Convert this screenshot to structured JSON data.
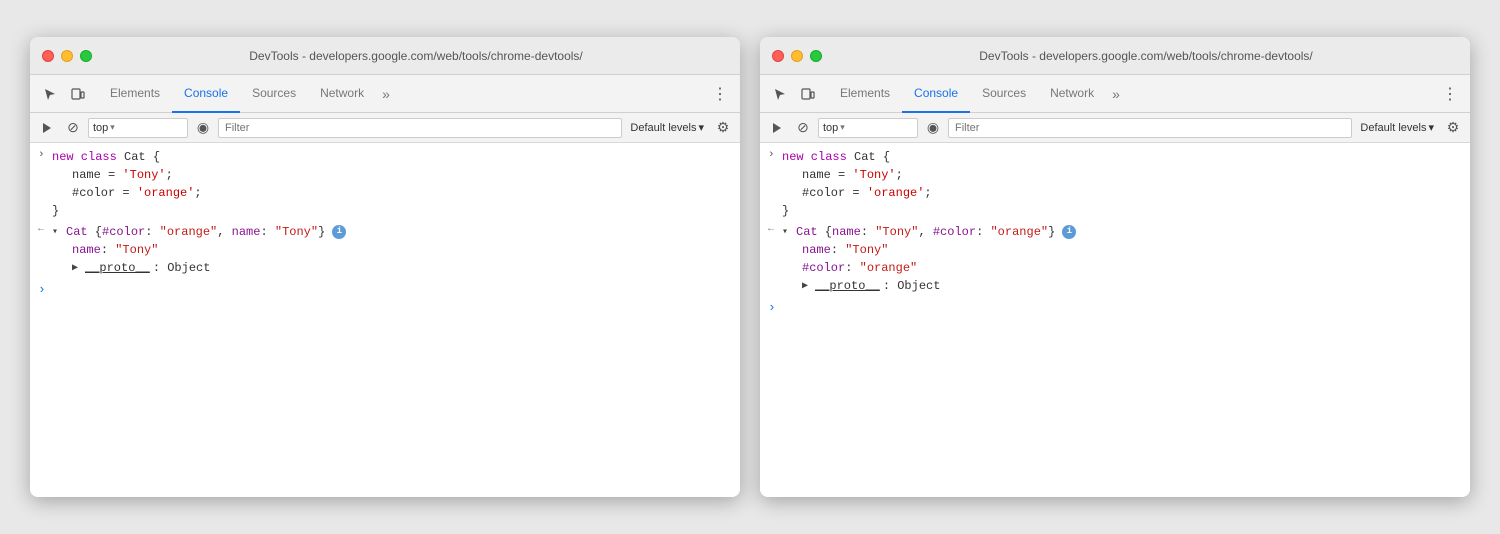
{
  "windows": [
    {
      "id": "window-left",
      "titleBar": {
        "title": "DevTools - developers.google.com/web/tools/chrome-devtools/"
      },
      "tabs": {
        "items": [
          "Elements",
          "Console",
          "Sources",
          "Network"
        ],
        "active": "Console",
        "more": "»"
      },
      "toolbar": {
        "executeIcon": "▶",
        "blockIcon": "⊘",
        "contextLabel": "top",
        "contextArrow": "▾",
        "eyeLabel": "◉",
        "filterPlaceholder": "Filter",
        "defaultLevelsLabel": "Default levels",
        "defaultLevelsArrow": "▾",
        "gearIcon": "⚙"
      },
      "console": {
        "entry1": {
          "arrow": ">",
          "lines": [
            "new class Cat {",
            "  name = 'Tony';",
            "  #color = 'orange';",
            "}"
          ]
        },
        "entry2": {
          "arrowLeft": "<",
          "triangleOpen": "▾",
          "objectLabel": "Cat {#color: ",
          "colorVal": "\"orange\"",
          "comma": ", name: ",
          "nameVal": "\"Tony\"",
          "closeBrace": "}",
          "hasInfoBadge": true,
          "children": [
            {
              "label": "name: ",
              "value": "\"Tony\"",
              "isStr": true
            },
            {
              "triangle": "▶",
              "label": "__proto__",
              "value": ": Object",
              "isProto": true
            }
          ]
        },
        "promptArrow": ">"
      }
    },
    {
      "id": "window-right",
      "titleBar": {
        "title": "DevTools - developers.google.com/web/tools/chrome-devtools/"
      },
      "tabs": {
        "items": [
          "Elements",
          "Console",
          "Sources",
          "Network"
        ],
        "active": "Console",
        "more": "»"
      },
      "toolbar": {
        "executeIcon": "▶",
        "blockIcon": "⊘",
        "contextLabel": "top",
        "contextArrow": "▾",
        "eyeLabel": "◉",
        "filterPlaceholder": "Filter",
        "defaultLevelsLabel": "Default levels",
        "defaultLevelsArrow": "▾",
        "gearIcon": "⚙"
      },
      "console": {
        "entry1": {
          "arrow": ">",
          "lines": [
            "new class Cat {",
            "  name = 'Tony';",
            "  #color = 'orange';",
            "}"
          ]
        },
        "entry2": {
          "arrowLeft": "<",
          "triangleOpen": "▾",
          "objectLabel": "Cat {name: ",
          "nameVal": "\"Tony\"",
          "comma": ", #color: ",
          "colorVal": "\"orange\"",
          "closeBrace": "}",
          "hasInfoBadge": true,
          "children": [
            {
              "label": "name: ",
              "value": "\"Tony\"",
              "isStr": true
            },
            {
              "label": "#color: ",
              "value": "\"orange\"",
              "isStr": true,
              "isPrivate": true
            },
            {
              "triangle": "▶",
              "label": "__proto__",
              "value": ": Object",
              "isProto": true
            }
          ]
        },
        "promptArrow": ">"
      }
    }
  ]
}
